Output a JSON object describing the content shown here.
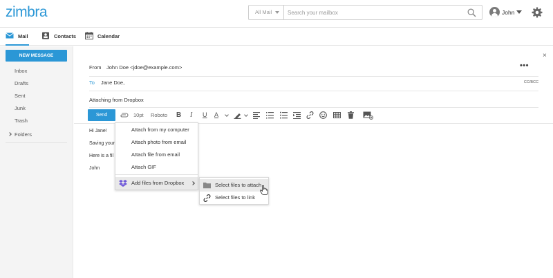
{
  "header": {
    "logo": "zimbra",
    "search_scope": "All Mail",
    "search_placeholder": "Search your mailbox",
    "user_name": "John"
  },
  "nav": {
    "tabs": [
      {
        "label": "Mail",
        "icon": "mail-icon",
        "active": true
      },
      {
        "label": "Contacts",
        "icon": "contacts-icon",
        "active": false
      },
      {
        "label": "Calendar",
        "icon": "calendar-icon",
        "active": false
      }
    ]
  },
  "sidebar": {
    "new_message": "NEW MESSAGE",
    "folders": [
      "Inbox",
      "Drafts",
      "Sent",
      "Junk",
      "Trash"
    ],
    "folders_toggle": "Folders"
  },
  "compose": {
    "from_label": "From",
    "from_value": "John Doe <jdoe@example.com>",
    "to_label": "To",
    "to_value": "Jane Doe,",
    "cc_bcc": "CC/BCC",
    "subject": "Attaching from Dropbox",
    "more_icon": "•••",
    "close_icon": "×"
  },
  "toolbar": {
    "send": "Send",
    "font_size": "10pt",
    "font_family": "Roboto",
    "bold": "B",
    "italic": "I",
    "underline": "U",
    "font_color": "A"
  },
  "body": {
    "lines": [
      "Hi Jane!",
      "Saving your",
      "Here is a fil",
      "John"
    ]
  },
  "attach_menu": {
    "items": [
      "Attach from my computer",
      "Attach photo from email",
      "Attach file from email",
      "Attach GIF"
    ],
    "dropbox": "Add files from Dropbox"
  },
  "dropbox_submenu": {
    "items": [
      "Select files to attach",
      "Select files to link"
    ]
  },
  "colors": {
    "accent": "#2b97d6",
    "dropbox": "#6e58d9"
  }
}
